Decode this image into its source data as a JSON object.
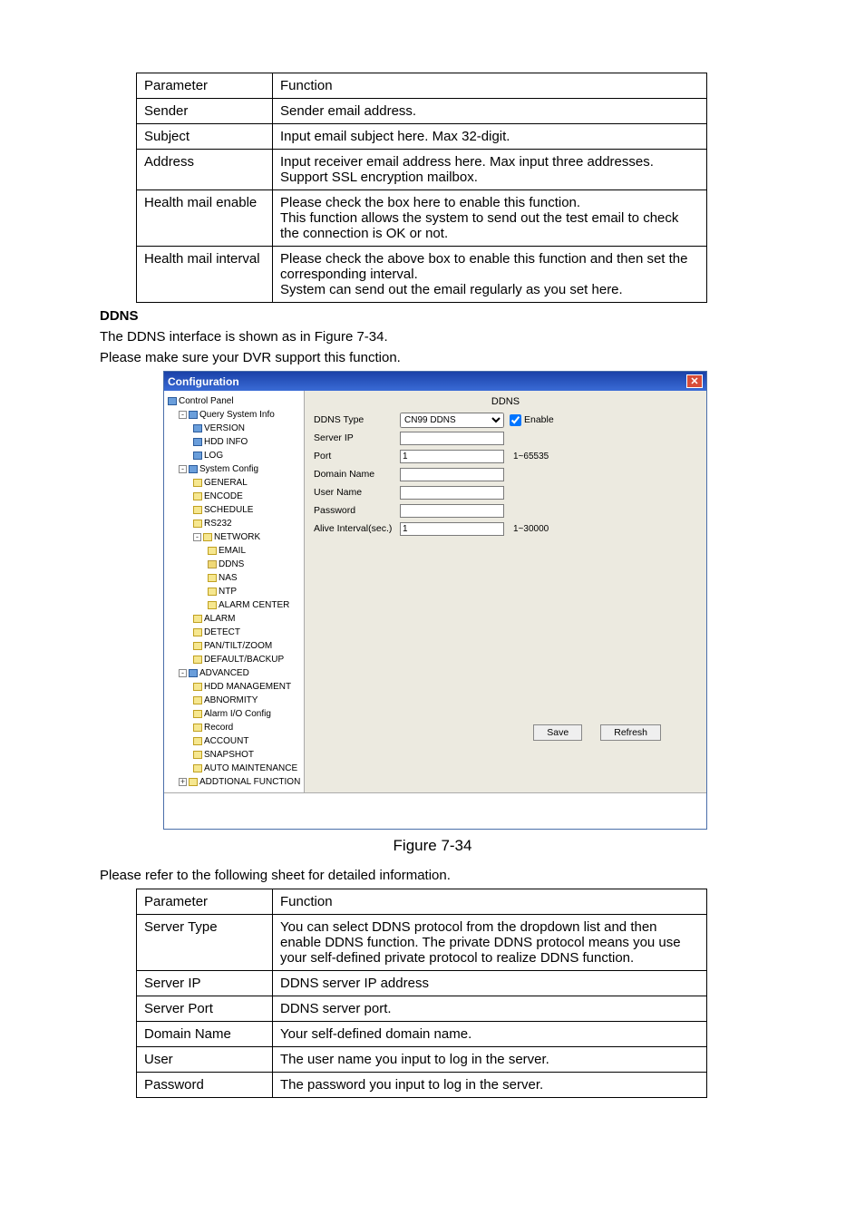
{
  "table1": {
    "headers": [
      "Parameter",
      "Function"
    ],
    "rows": [
      [
        "Sender",
        "Sender email address."
      ],
      [
        "Subject",
        "Input email subject here. Max 32-digit."
      ],
      [
        "Address",
        "Input receiver email address here. Max input three addresses. Support SSL encryption mailbox."
      ],
      [
        "Health mail enable",
        "Please check the box here to enable this function.\nThis function allows the system to send out the test email to check the connection is OK or not."
      ],
      [
        "Health mail interval",
        "Please check the above box to enable this function and then set the corresponding interval.\nSystem can send out the email regularly as you set here."
      ]
    ]
  },
  "section": {
    "title": "DDNS",
    "line1": "The DDNS interface is shown as in Figure 7-34.",
    "line2": "Please make sure your DVR support this function."
  },
  "config": {
    "title": "Configuration",
    "form_title": "DDNS",
    "labels": {
      "ddns_type": "DDNS Type",
      "server_ip": "Server IP",
      "port": "Port",
      "domain": "Domain Name",
      "user": "User Name",
      "password": "Password",
      "alive": "Alive Interval(sec.)",
      "enable": "Enable",
      "save": "Save",
      "refresh": "Refresh"
    },
    "values": {
      "ddns_type": "CN99 DDNS",
      "port": "1",
      "alive": "1",
      "port_hint": "1~65535",
      "alive_hint": "1~30000"
    },
    "tree": {
      "root": "Control Panel",
      "query": "Query System Info",
      "version": "VERSION",
      "hdd_info": "HDD INFO",
      "log": "LOG",
      "system_config": "System Config",
      "general": "GENERAL",
      "encode": "ENCODE",
      "schedule": "SCHEDULE",
      "rs232": "RS232",
      "network": "NETWORK",
      "email": "EMAIL",
      "ddns": "DDNS",
      "nas": "NAS",
      "ntp": "NTP",
      "alarm_center": "ALARM CENTER",
      "alarm": "ALARM",
      "detect": "DETECT",
      "ptz": "PAN/TILT/ZOOM",
      "default_backup": "DEFAULT/BACKUP",
      "advanced": "ADVANCED",
      "hdd_mgmt": "HDD MANAGEMENT",
      "abnormity": "ABNORMITY",
      "alarm_io": "Alarm I/O Config",
      "record": "Record",
      "account": "ACCOUNT",
      "snapshot": "SNAPSHOT",
      "auto_maint": "AUTO MAINTENANCE",
      "additional": "ADDTIONAL FUNCTION"
    }
  },
  "figure_caption": "Figure 7-34",
  "note": "Please refer to the following sheet for detailed information.",
  "table2": {
    "headers": [
      "Parameter",
      "Function"
    ],
    "rows": [
      [
        "Server Type",
        "You can select DDNS protocol from the dropdown list and then enable DDNS function. The private DDNS protocol means you use your self-defined private protocol to realize DDNS function."
      ],
      [
        "Server IP",
        "DDNS server IP address"
      ],
      [
        "Server Port",
        "DDNS server port."
      ],
      [
        "Domain Name",
        "Your self-defined domain name."
      ],
      [
        "User",
        "The user name you input to log in the server."
      ],
      [
        "Password",
        "The password you input to log in the server."
      ]
    ]
  }
}
